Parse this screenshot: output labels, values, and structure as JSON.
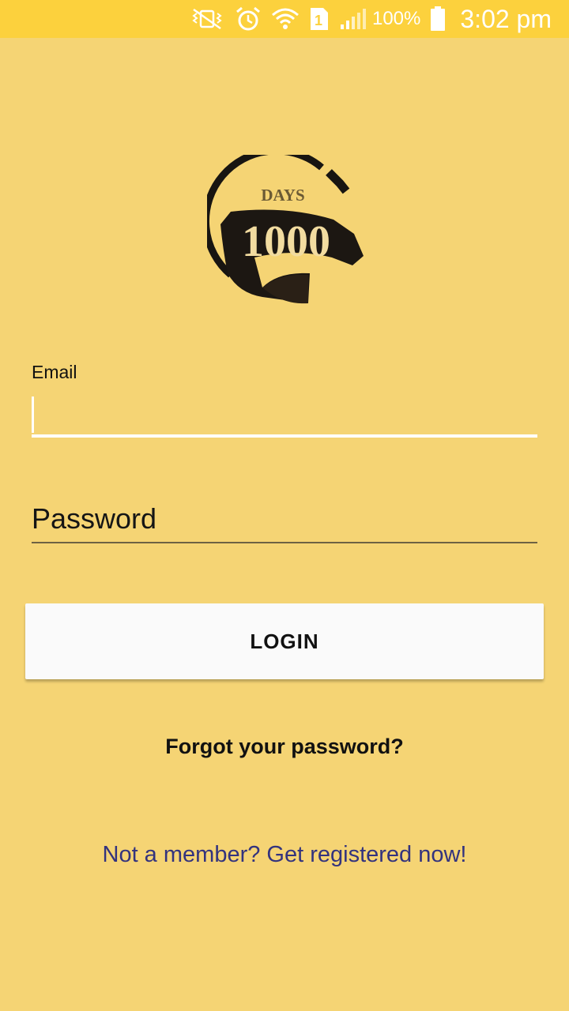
{
  "status_bar": {
    "battery_percent": "100%",
    "time": "3:02 pm",
    "sim_slot": "1",
    "icons": [
      "vibrate-mute-icon",
      "alarm-icon",
      "wifi-icon",
      "sim-icon",
      "signal-icon",
      "battery-icon"
    ]
  },
  "logo": {
    "top_text": "DAYS",
    "number_text": "1000"
  },
  "form": {
    "email_label": "Email",
    "email_value": "",
    "password_placeholder": "Password",
    "login_label": "LOGIN",
    "forgot_link": "Forgot your password?",
    "register_link": "Not a member? Get registered now!"
  },
  "colors": {
    "background": "#f5d474",
    "status_bar": "#fcd13d",
    "link": "#33337e"
  }
}
